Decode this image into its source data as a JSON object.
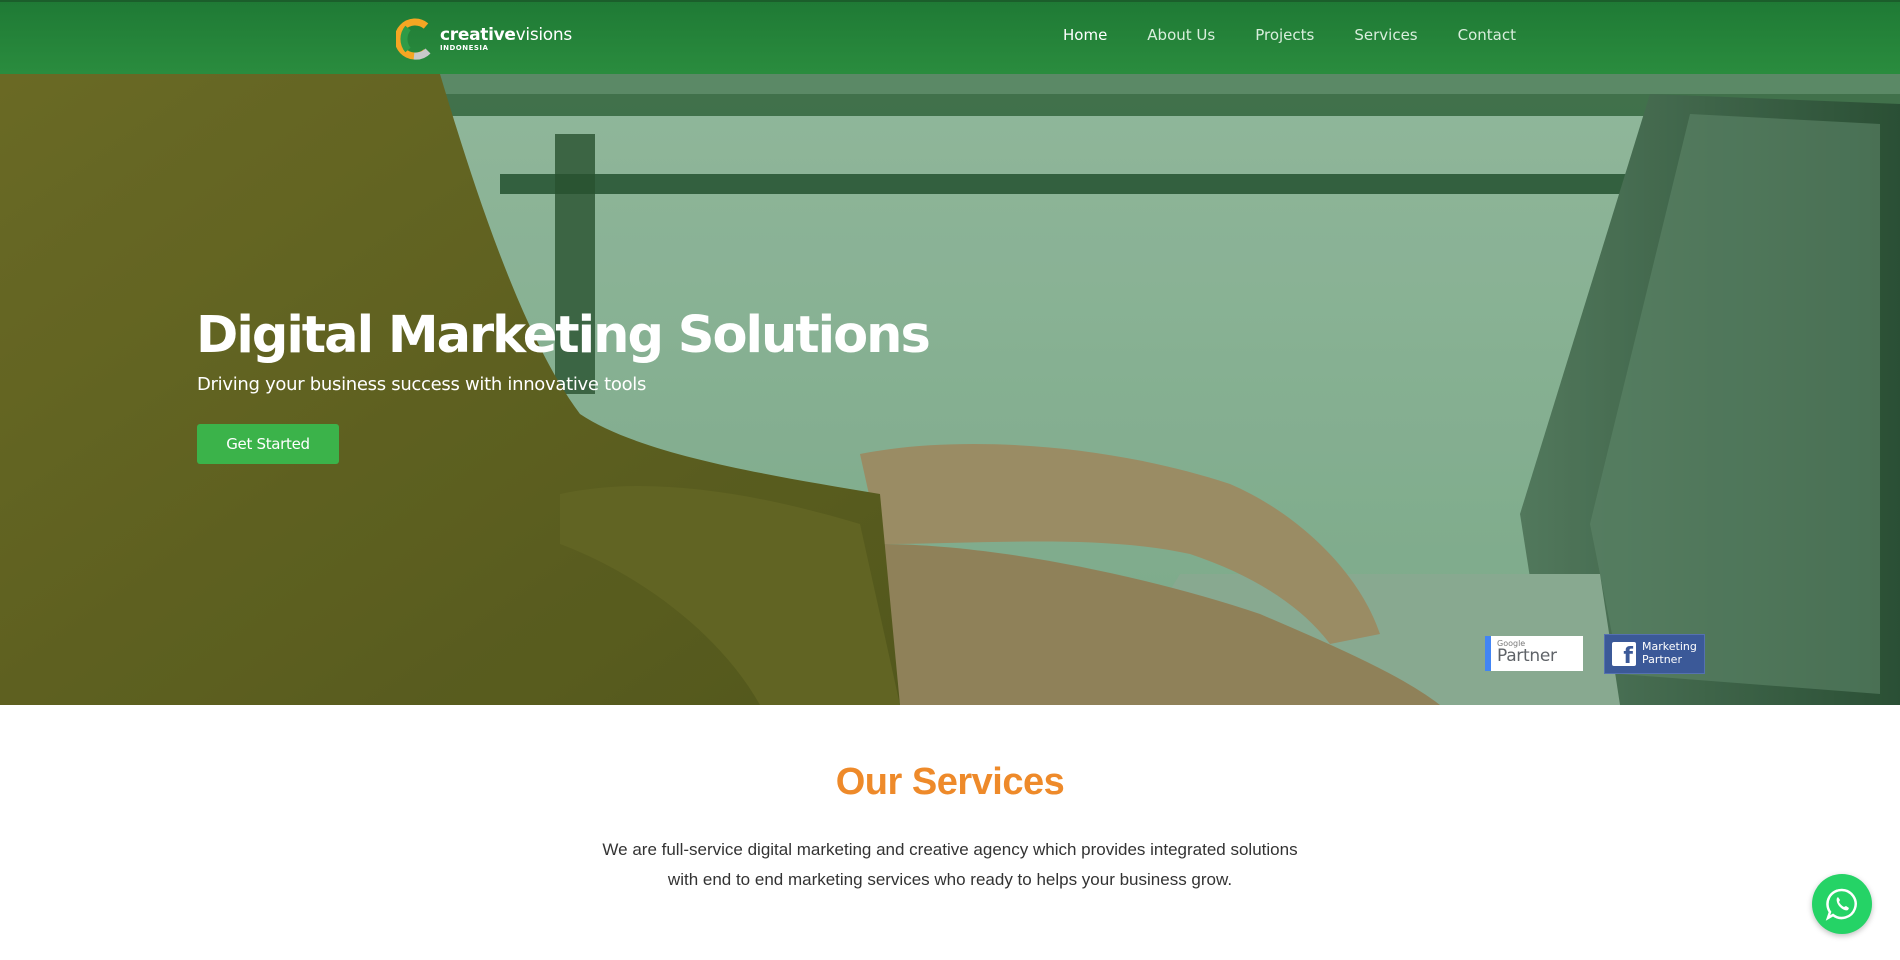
{
  "header": {
    "logo": {
      "word_bold": "creative",
      "word_light": "visions",
      "sub": "INDONESIA"
    },
    "nav": [
      {
        "label": "Home",
        "active": true
      },
      {
        "label": "About Us",
        "active": false
      },
      {
        "label": "Projects",
        "active": false
      },
      {
        "label": "Services",
        "active": false
      },
      {
        "label": "Contact",
        "active": false
      }
    ]
  },
  "hero": {
    "title": "Digital Marketing Solutions",
    "subtitle": "Driving your business success with innovative tools",
    "cta_label": "Get Started",
    "badges": {
      "google_small": "Google",
      "google_big": "Partner",
      "fb_line1": "Marketing",
      "fb_line2": "Partner",
      "fb_icon": "f"
    }
  },
  "services": {
    "title": "Our Services",
    "description": "We are full-service digital marketing and creative agency which provides integrated solutions with end to end marketing services who ready to helps your business grow."
  },
  "floating": {
    "whatsapp_icon": "whatsapp-icon"
  },
  "colors": {
    "nav_green": "#2a8c3e",
    "cta_green": "#3bb34a",
    "accent_orange": "#ee8a2a",
    "whatsapp_green": "#25d366",
    "facebook_blue": "#3b5998",
    "google_blue": "#4285f4"
  }
}
